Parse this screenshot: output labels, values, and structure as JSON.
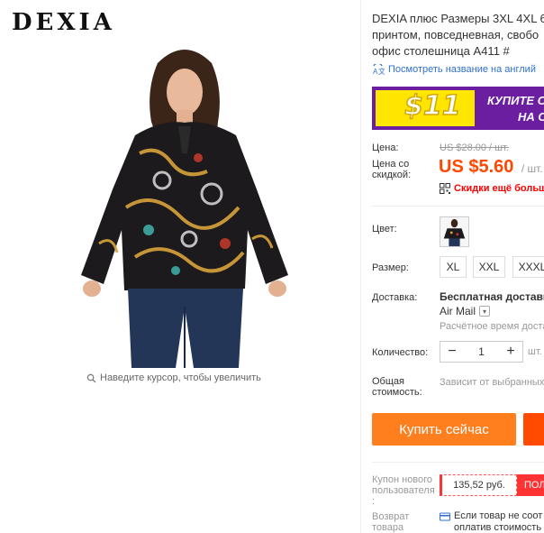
{
  "gallery": {
    "brand": "DEXIA",
    "zoom_hint": "Наведите курсор, чтобы увеличить"
  },
  "product": {
    "title_lines": [
      "DEXIA плюс Размеры 3XL 4XL 6",
      "принтом, повседневная, свобо",
      "офис столешница A411 #"
    ],
    "translate_link": "Посмотреть название на англий"
  },
  "banner": {
    "amount": "$11",
    "cta_line1": "КУПИТЕ С",
    "cta_line2": "НА С",
    "colors": {
      "bg": "#6c1ea0",
      "accent": "#ffe600"
    }
  },
  "pricing": {
    "price_label": "Цена:",
    "old_price": "US $28.00 / шт.",
    "discount_label_1": "Цена со",
    "discount_label_2": "скидкой:",
    "price_value": "US $5.60",
    "price_unit": "/ шт.",
    "qr_text": "Скидки ещё больше",
    "accent_color": "#ff4700"
  },
  "options": {
    "color_label": "Цвет:",
    "size_label": "Размер:",
    "sizes": [
      "XL",
      "XXL",
      "XXXL"
    ]
  },
  "shipping": {
    "label": "Доставка:",
    "title": "Бесплатная доставка",
    "method": "Air Mail",
    "time": "Расчётное время доставк"
  },
  "quantity": {
    "label": "Количество:",
    "minus": "−",
    "value": "1",
    "plus": "+",
    "unit": "шт."
  },
  "total": {
    "label_1": "Общая",
    "label_2": "стоимость:",
    "note": "Зависит от выбранных"
  },
  "actions": {
    "buy_now": "Купить сейчас"
  },
  "coupon": {
    "label_1": "Купон нового",
    "label_2": "пользователя",
    "label_3": ":",
    "value": "135,52 руб.",
    "get": "ПОЛ"
  },
  "returns": {
    "label_1": "Возврат",
    "label_2": "товара",
    "text_1": "Если товар не соот",
    "text_2": "оплатив стоимость"
  }
}
